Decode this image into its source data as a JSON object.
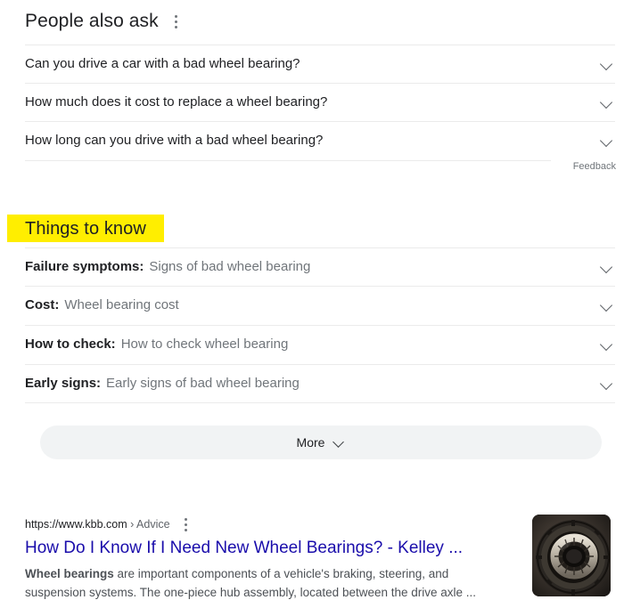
{
  "people_also_ask": {
    "title": "People also ask",
    "menu_icon": "kebab-menu-icon",
    "questions": [
      "Can you drive a car with a bad wheel bearing?",
      "How much does it cost to replace a wheel bearing?",
      "How long can you drive with a bad wheel bearing?"
    ],
    "feedback_label": "Feedback"
  },
  "things_to_know": {
    "title": "Things to know",
    "highlight_color": "#ffee00",
    "rows": [
      {
        "label": "Failure symptoms:",
        "description": "Signs of bad wheel bearing"
      },
      {
        "label": "Cost:",
        "description": "Wheel bearing cost"
      },
      {
        "label": "How to check:",
        "description": "How to check wheel bearing"
      },
      {
        "label": "Early signs:",
        "description": "Early signs of bad wheel bearing"
      }
    ],
    "more_button": {
      "label": "More",
      "icon": "chevron-down-icon"
    }
  },
  "result": {
    "url": "https://www.kbb.com",
    "breadcrumb": "› Advice",
    "menu_icon": "kebab-menu-icon",
    "title": "How Do I Know If I Need New Wheel Bearings? - Kelley ...",
    "snippet_bold": "Wheel bearings",
    "snippet_rest": " are important components of a vehicle's braking, steering, and suspension systems. The one-piece hub assembly, located between the drive axle ...",
    "thumbnail_alt": "tapered-roller-bearing-photo",
    "link_color": "#1a0dab"
  }
}
